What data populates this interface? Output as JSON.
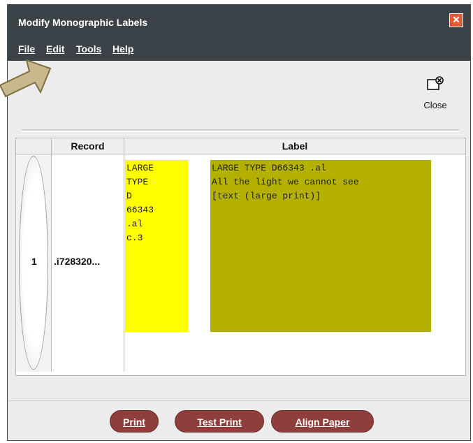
{
  "window": {
    "title": "Modify Monographic Labels"
  },
  "menu": [
    "File",
    "Edit",
    "Tools",
    "Help"
  ],
  "toolbar": {
    "close_label": "Close"
  },
  "table": {
    "headers": {
      "record": "Record",
      "label": "Label"
    },
    "rows": [
      {
        "num": "1",
        "record": ".i728320...",
        "spine": [
          "LARGE",
          "TYPE",
          "D",
          "66343",
          ".al",
          "c.3"
        ],
        "pocket": [
          "LARGE TYPE D66343 .al",
          "All the light we cannot see",
          "[text (large print)]"
        ]
      }
    ]
  },
  "buttons": {
    "print": "Print",
    "test_print": "Test Print",
    "align_paper": "Align Paper"
  },
  "colors": {
    "spine": "#ffff00",
    "pocket": "#b3b000",
    "button": "#8f3f3b",
    "titlebar": "#3c4348"
  }
}
